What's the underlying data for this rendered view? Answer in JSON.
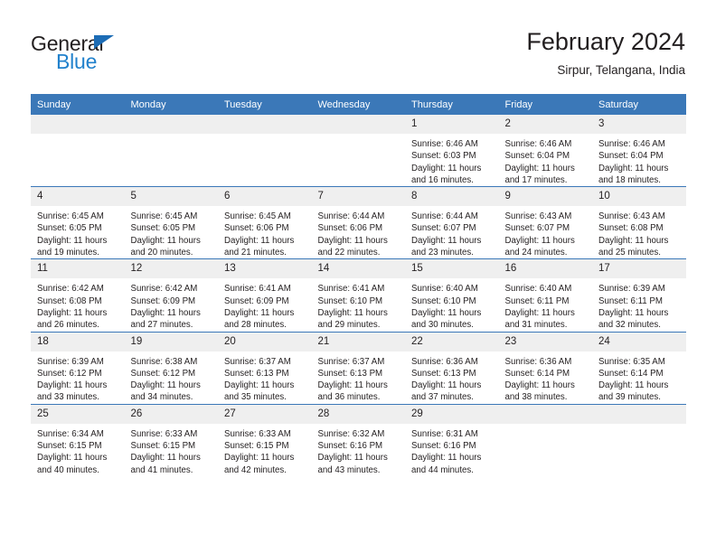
{
  "brand": {
    "name_part1": "General",
    "name_part2": "Blue",
    "triangle_color": "#1c6cb5",
    "blue_color": "#2181cc"
  },
  "header": {
    "title": "February 2024",
    "subtitle": "Sirpur, Telangana, India"
  },
  "theme": {
    "header_blue": "#3b78b8",
    "daynum_band": "#efefef",
    "text": "#231f20"
  },
  "weekday_headers": [
    "Sunday",
    "Monday",
    "Tuesday",
    "Wednesday",
    "Thursday",
    "Friday",
    "Saturday"
  ],
  "weeks": [
    [
      {
        "day": "",
        "lines": []
      },
      {
        "day": "",
        "lines": []
      },
      {
        "day": "",
        "lines": []
      },
      {
        "day": "",
        "lines": []
      },
      {
        "day": "1",
        "lines": [
          "Sunrise: 6:46 AM",
          "Sunset: 6:03 PM",
          "Daylight: 11 hours and 16 minutes."
        ]
      },
      {
        "day": "2",
        "lines": [
          "Sunrise: 6:46 AM",
          "Sunset: 6:04 PM",
          "Daylight: 11 hours and 17 minutes."
        ]
      },
      {
        "day": "3",
        "lines": [
          "Sunrise: 6:46 AM",
          "Sunset: 6:04 PM",
          "Daylight: 11 hours and 18 minutes."
        ]
      }
    ],
    [
      {
        "day": "4",
        "lines": [
          "Sunrise: 6:45 AM",
          "Sunset: 6:05 PM",
          "Daylight: 11 hours and 19 minutes."
        ]
      },
      {
        "day": "5",
        "lines": [
          "Sunrise: 6:45 AM",
          "Sunset: 6:05 PM",
          "Daylight: 11 hours and 20 minutes."
        ]
      },
      {
        "day": "6",
        "lines": [
          "Sunrise: 6:45 AM",
          "Sunset: 6:06 PM",
          "Daylight: 11 hours and 21 minutes."
        ]
      },
      {
        "day": "7",
        "lines": [
          "Sunrise: 6:44 AM",
          "Sunset: 6:06 PM",
          "Daylight: 11 hours and 22 minutes."
        ]
      },
      {
        "day": "8",
        "lines": [
          "Sunrise: 6:44 AM",
          "Sunset: 6:07 PM",
          "Daylight: 11 hours and 23 minutes."
        ]
      },
      {
        "day": "9",
        "lines": [
          "Sunrise: 6:43 AM",
          "Sunset: 6:07 PM",
          "Daylight: 11 hours and 24 minutes."
        ]
      },
      {
        "day": "10",
        "lines": [
          "Sunrise: 6:43 AM",
          "Sunset: 6:08 PM",
          "Daylight: 11 hours and 25 minutes."
        ]
      }
    ],
    [
      {
        "day": "11",
        "lines": [
          "Sunrise: 6:42 AM",
          "Sunset: 6:08 PM",
          "Daylight: 11 hours and 26 minutes."
        ]
      },
      {
        "day": "12",
        "lines": [
          "Sunrise: 6:42 AM",
          "Sunset: 6:09 PM",
          "Daylight: 11 hours and 27 minutes."
        ]
      },
      {
        "day": "13",
        "lines": [
          "Sunrise: 6:41 AM",
          "Sunset: 6:09 PM",
          "Daylight: 11 hours and 28 minutes."
        ]
      },
      {
        "day": "14",
        "lines": [
          "Sunrise: 6:41 AM",
          "Sunset: 6:10 PM",
          "Daylight: 11 hours and 29 minutes."
        ]
      },
      {
        "day": "15",
        "lines": [
          "Sunrise: 6:40 AM",
          "Sunset: 6:10 PM",
          "Daylight: 11 hours and 30 minutes."
        ]
      },
      {
        "day": "16",
        "lines": [
          "Sunrise: 6:40 AM",
          "Sunset: 6:11 PM",
          "Daylight: 11 hours and 31 minutes."
        ]
      },
      {
        "day": "17",
        "lines": [
          "Sunrise: 6:39 AM",
          "Sunset: 6:11 PM",
          "Daylight: 11 hours and 32 minutes."
        ]
      }
    ],
    [
      {
        "day": "18",
        "lines": [
          "Sunrise: 6:39 AM",
          "Sunset: 6:12 PM",
          "Daylight: 11 hours and 33 minutes."
        ]
      },
      {
        "day": "19",
        "lines": [
          "Sunrise: 6:38 AM",
          "Sunset: 6:12 PM",
          "Daylight: 11 hours and 34 minutes."
        ]
      },
      {
        "day": "20",
        "lines": [
          "Sunrise: 6:37 AM",
          "Sunset: 6:13 PM",
          "Daylight: 11 hours and 35 minutes."
        ]
      },
      {
        "day": "21",
        "lines": [
          "Sunrise: 6:37 AM",
          "Sunset: 6:13 PM",
          "Daylight: 11 hours and 36 minutes."
        ]
      },
      {
        "day": "22",
        "lines": [
          "Sunrise: 6:36 AM",
          "Sunset: 6:13 PM",
          "Daylight: 11 hours and 37 minutes."
        ]
      },
      {
        "day": "23",
        "lines": [
          "Sunrise: 6:36 AM",
          "Sunset: 6:14 PM",
          "Daylight: 11 hours and 38 minutes."
        ]
      },
      {
        "day": "24",
        "lines": [
          "Sunrise: 6:35 AM",
          "Sunset: 6:14 PM",
          "Daylight: 11 hours and 39 minutes."
        ]
      }
    ],
    [
      {
        "day": "25",
        "lines": [
          "Sunrise: 6:34 AM",
          "Sunset: 6:15 PM",
          "Daylight: 11 hours and 40 minutes."
        ]
      },
      {
        "day": "26",
        "lines": [
          "Sunrise: 6:33 AM",
          "Sunset: 6:15 PM",
          "Daylight: 11 hours and 41 minutes."
        ]
      },
      {
        "day": "27",
        "lines": [
          "Sunrise: 6:33 AM",
          "Sunset: 6:15 PM",
          "Daylight: 11 hours and 42 minutes."
        ]
      },
      {
        "day": "28",
        "lines": [
          "Sunrise: 6:32 AM",
          "Sunset: 6:16 PM",
          "Daylight: 11 hours and 43 minutes."
        ]
      },
      {
        "day": "29",
        "lines": [
          "Sunrise: 6:31 AM",
          "Sunset: 6:16 PM",
          "Daylight: 11 hours and 44 minutes."
        ]
      },
      {
        "day": "",
        "lines": []
      },
      {
        "day": "",
        "lines": []
      }
    ]
  ]
}
